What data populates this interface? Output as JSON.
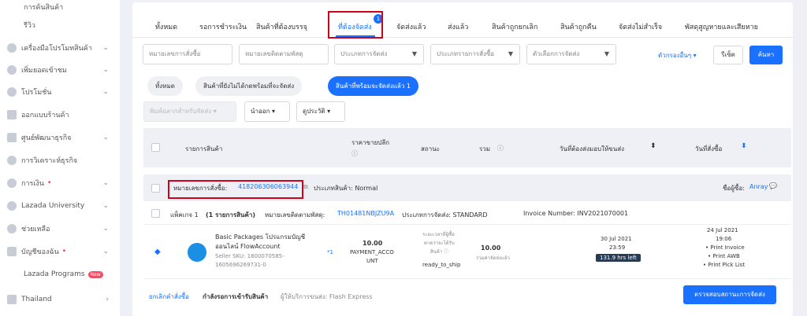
{
  "sidebar": {
    "items": [
      {
        "label": "การค้นสินค้า"
      },
      {
        "label": "รีวิว"
      },
      {
        "label": "เครื่องมือโปรโมทสินค้า"
      },
      {
        "label": "เพิ่มยอดเข้าชม"
      },
      {
        "label": "โปรโมชั่น"
      },
      {
        "label": "ออกแบบร้านค้า"
      },
      {
        "label": "ศูนย์พัฒนาธุรกิจ"
      },
      {
        "label": "การวิเคราะห์ธุรกิจ"
      },
      {
        "label": "การเงิน"
      },
      {
        "label": "Lazada University"
      },
      {
        "label": "ช่วยเหลือ"
      },
      {
        "label": "บัญชีของฉัน"
      },
      {
        "label": "Lazada Programs"
      },
      {
        "label": "Thailand"
      }
    ],
    "new_label": "New",
    "red_dot": "•"
  },
  "tabs": [
    "ทั้งหมด",
    "รอการชำระเงิน",
    "สินค้าที่ต้องบรรจุ",
    "ที่ต้องจัดส่ง",
    "จัดส่งแล้ว",
    "ส่งแล้ว",
    "สินค้าถูกยกเลิก",
    "สินค้าถูกคืน",
    "จัดส่งไม่สำเร็จ",
    "พัสดุสูญหายและเสียหาย"
  ],
  "tab_badge": "1",
  "filters": {
    "order_no": "หมายเลขการสั่งซื้อ",
    "tracking_no": "หมายเลขติดตามพัสดุ",
    "ship_type": "ประเภทการจัดส่ง",
    "order_type": "ประเภทรายการสั่งซื้อ",
    "ship_option": "ตัวเลือกการจัดส่ง",
    "more": "ตัวกรองอื่นๆ ▾",
    "reset": "รีเซ็ต",
    "search": "ค้นหา"
  },
  "pills": [
    "ทั้งหมด",
    "สินค้าที่ยังไม่ได้กดพร้อมที่จะจัดส่ง",
    "สินค้าที่พร้อมจะจัดส่งแล้ว 1"
  ],
  "actions": {
    "print": "พิมพ์ฉลากสำหรับจัดส่ง",
    "export": "นำออก",
    "history": "ดูประวัติ"
  },
  "columns": {
    "product": "รายการสินค้า",
    "price": "ราคาขายปลีก",
    "status": "สถานะ",
    "total": "รวม",
    "ship_by": "วันที่ต้องส่งมอบให้ขนส่ง",
    "order_date": "วันที่สั่งซื้อ"
  },
  "order": {
    "label": "หมายเลขการสั่งซื้อ:",
    "number": "418206306063944",
    "type": "ประเภทสินค้า:  Normal",
    "buyer_label": "ชื่อผู้ซื้อ:",
    "buyer": "Anray"
  },
  "package": {
    "prefix": "แพ็คเกจ 1",
    "count": "(1 รายการสินค้า)",
    "tracking_label": "หมายเลขติดตามพัสดุ:",
    "tracking": "TH01481NBJZU9A",
    "ship_type": "ประเภทการจัดส่ง: STANDARD",
    "invoice": "Invoice Number: INV2021070001"
  },
  "product": {
    "name1": "Basic Packages โปรแกรมบัญชี",
    "name2": "ออนไลน์ FlowAccount",
    "sku1": "Seller SKU: 1800070585-",
    "sku2": "1605696269731-0",
    "qty": "*1",
    "price": "10.00",
    "method1": "PAYMENT_ACCO",
    "method2": "UNT",
    "hint1": "ระยะเวลาที่ผู้ซื้อ",
    "hint2": "คาดว่าจะได้รับ",
    "hint3": "สินค้า ⓘ",
    "status": "ready_to_ship",
    "total": "10.00",
    "total_sub": "รวมค่าจัดส่งแล้ว",
    "ship_date": "30 Jul 2021",
    "ship_time": "23:59",
    "hrs_left": "131.9 hrs left",
    "order_date": "24 Jul 2021",
    "order_time": "19:06",
    "links": [
      "Print Invoice",
      "Print AWB",
      "Print Pick List"
    ]
  },
  "footer": {
    "cancel": "ยกเลิกคำสั่งซื้อ",
    "status": "กำลังรอการเข้ารับสินค้า",
    "provider": "ผู้ให้บริการขนส่ง: Flash Express",
    "check": "ตรวจสอบสถานะการจัดส่ง"
  },
  "colors": {
    "accent": "#1a71ff",
    "highlight": "#d0021b",
    "dark_badge": "#273b53"
  }
}
